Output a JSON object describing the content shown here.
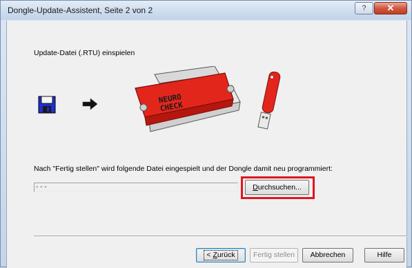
{
  "window": {
    "title": "Dongle-Update-Assistent, Seite 2 von 2",
    "help_glyph": "?",
    "close_glyph": "✕"
  },
  "content": {
    "heading": "Update-Datei (.RTU) einspielen",
    "info_text": "Nach \"Fertig stellen\" wird folgende Datei eingespielt und der Dongle damit neu programmiert:",
    "file_path": "- - -",
    "browse_label_underlined": "D",
    "browse_label_rest": "urchsuchen..."
  },
  "dongle_image": {
    "label_line1": "NEURO",
    "label_line2": "CHECK",
    "accent_color": "#e3261c"
  },
  "icons": {
    "floppy": "floppy-disk-icon",
    "arrow": "right-arrow-icon"
  },
  "buttons": {
    "back_prefix": "< ",
    "back_underlined": "Z",
    "back_rest": "urück",
    "finish": "Fertig stellen",
    "cancel": "Abbrechen",
    "help": "Hilfe"
  },
  "highlight_color": "#e0151e"
}
